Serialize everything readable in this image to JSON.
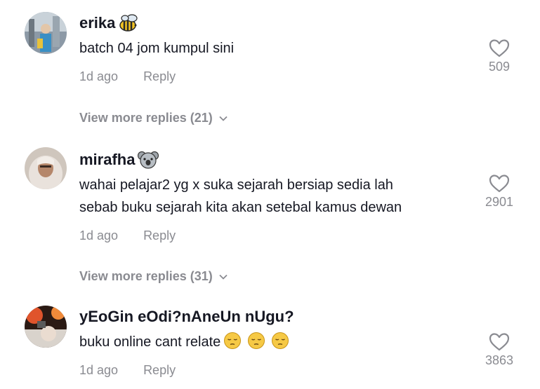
{
  "comments": [
    {
      "username": "erika",
      "badge_icon": "bee-emoji-icon",
      "text": "batch 04 jom kumpul sini",
      "time": "1d ago",
      "reply_label": "Reply",
      "likes": "509",
      "view_more": "View more replies (21)"
    },
    {
      "username": "mirafha",
      "badge_icon": "koala-emoji-icon",
      "text_line1": "wahai pelajar2 yg x suka sejarah bersiap sedia lah",
      "text_line2": "sebab buku sejarah kita akan setebal kamus dewan",
      "time": "1d ago",
      "reply_label": "Reply",
      "likes": "2901",
      "view_more": "View more replies (31)"
    },
    {
      "username": "yEoGin eOdi?nAneUn nUgu?",
      "text": "buku online cant relate",
      "trailing_emoji_icons": [
        "pensive-face-emoji-icon",
        "pensive-face-emoji-icon",
        "pensive-face-emoji-icon"
      ],
      "time": "1d ago",
      "reply_label": "Reply",
      "likes": "3863"
    }
  ],
  "colors": {
    "text": "#161823",
    "muted": "#8a8b91",
    "background": "#ffffff"
  }
}
